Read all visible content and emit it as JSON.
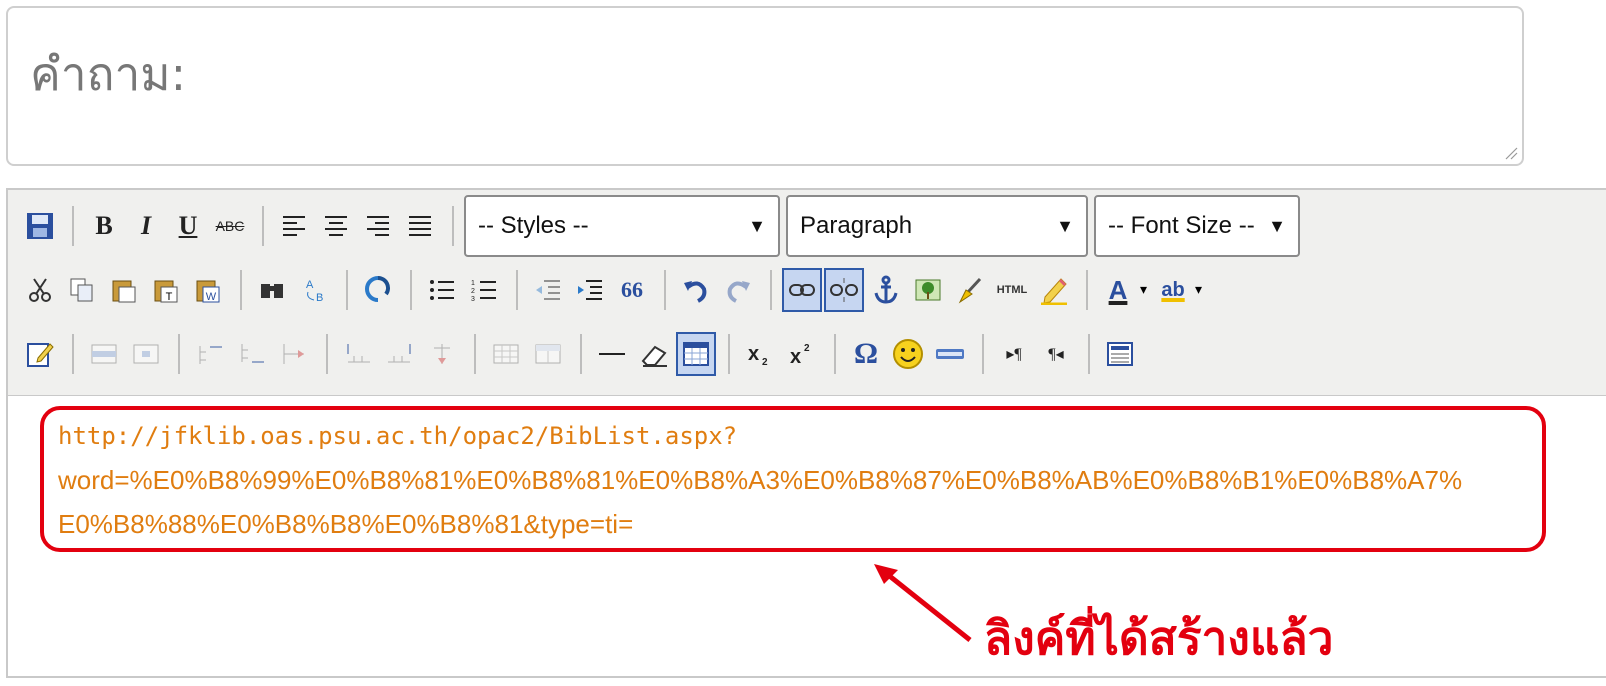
{
  "question": {
    "label": "คำถาม:"
  },
  "editor": {
    "styles_select": "-- Styles --",
    "format_select": "Paragraph",
    "fontsize_select": "-- Font Size --",
    "toolbar_text": {
      "html": "HTML",
      "text_color": "A",
      "highlight": "ab",
      "bold": "B",
      "italic": "I",
      "underline": "U",
      "strike": "ABC",
      "omega": "Ω",
      "quote": "66"
    },
    "content_link": {
      "line1": "http://jfklib.oas.psu.ac.th/opac2/BibList.aspx?",
      "line2": "word=%E0%B8%99%E0%B8%81%E0%B8%81%E0%B8%A3%E0%B8%87%E0%B8%AB%E0%B8%B1%E0%B8%A7%",
      "line3": "E0%B8%88%E0%B8%B8%E0%B8%81&type=ti="
    }
  },
  "annotation": {
    "text": "ลิงค์ที่ได้สร้างแล้ว",
    "color": "#e3000f"
  },
  "colors": {
    "link": "#e07d10",
    "highlight_border": "#e3000f",
    "toolbar_bg": "#f0f0ee"
  }
}
